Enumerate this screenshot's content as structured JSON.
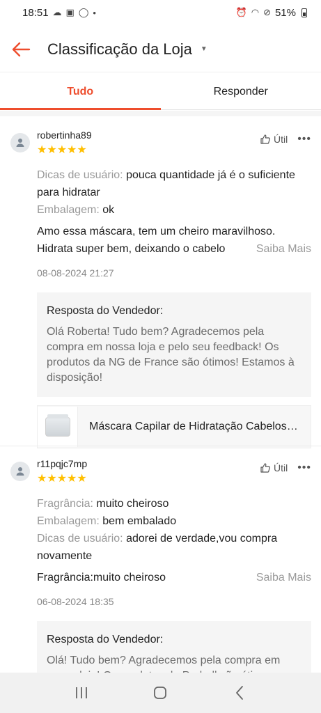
{
  "status_bar": {
    "time": "18:51",
    "left_icons": [
      "cloud-icon",
      "image-icon",
      "whatsapp-icon",
      "dot-icon"
    ],
    "right_icons": [
      "alarm-icon",
      "wifi-icon",
      "do-not-disturb-icon"
    ],
    "battery": "51%"
  },
  "header": {
    "title": "Classificação da Loja",
    "back_icon": "arrow-left-icon",
    "dropdown_icon": "caret-down-icon"
  },
  "tabs": [
    {
      "label": "Tudo",
      "active": true
    },
    {
      "label": "Responder",
      "active": false
    }
  ],
  "colors": {
    "accent": "#ee4d2d",
    "star": "#ffbf00",
    "muted_text": "#999999"
  },
  "reviews": [
    {
      "username": "robertinha89",
      "rating": 5,
      "stars_text": "★★★★★",
      "util_label": "Útil",
      "attributes": [
        {
          "label": "Dicas de usuário:",
          "value": " pouca quantidade já é o suficiente para hidratar"
        },
        {
          "label": "Embalagem:",
          "value": " ok"
        }
      ],
      "comment_line1": "Amo essa máscara, tem um cheiro maravilhoso.",
      "comment_line2": "Hidrata super bem, deixando o cabelo",
      "more_label": "Saiba Mais",
      "date": "08-08-2024 21:27",
      "seller_reply_title": "Resposta do Vendedor:",
      "seller_reply_text": "Olá Roberta! Tudo bem? Agradecemos pela compra em nossa loja e pelo seu feedback! Os produtos da NG de France são ótimos! Estamos à disposição!",
      "product_name": "Máscara Capilar de Hidratação Cabelos Danificados"
    },
    {
      "username": "r11pqjc7mp",
      "rating": 5,
      "stars_text": "★★★★★",
      "util_label": "Útil",
      "attributes": [
        {
          "label": "Fragrância:",
          "value": " muito cheiroso"
        },
        {
          "label": "Embalagem:",
          "value": " bem embalado"
        },
        {
          "label": "Dicas de usuário:",
          "value": " adorei de verdade,vou compra novamente"
        }
      ],
      "comment_line1": "Fragrância:muito cheiroso",
      "more_label": "Saiba Mais",
      "date": "06-08-2024 18:35",
      "seller_reply_title": "Resposta do Vendedor:",
      "seller_reply_text": "Olá! Tudo bem? Agradecemos pela compra em nossa loja! Os produtos da Prohall são ótimos"
    }
  ],
  "nav_bar": {
    "buttons": [
      "recent-apps-icon",
      "home-icon",
      "back-icon"
    ]
  }
}
